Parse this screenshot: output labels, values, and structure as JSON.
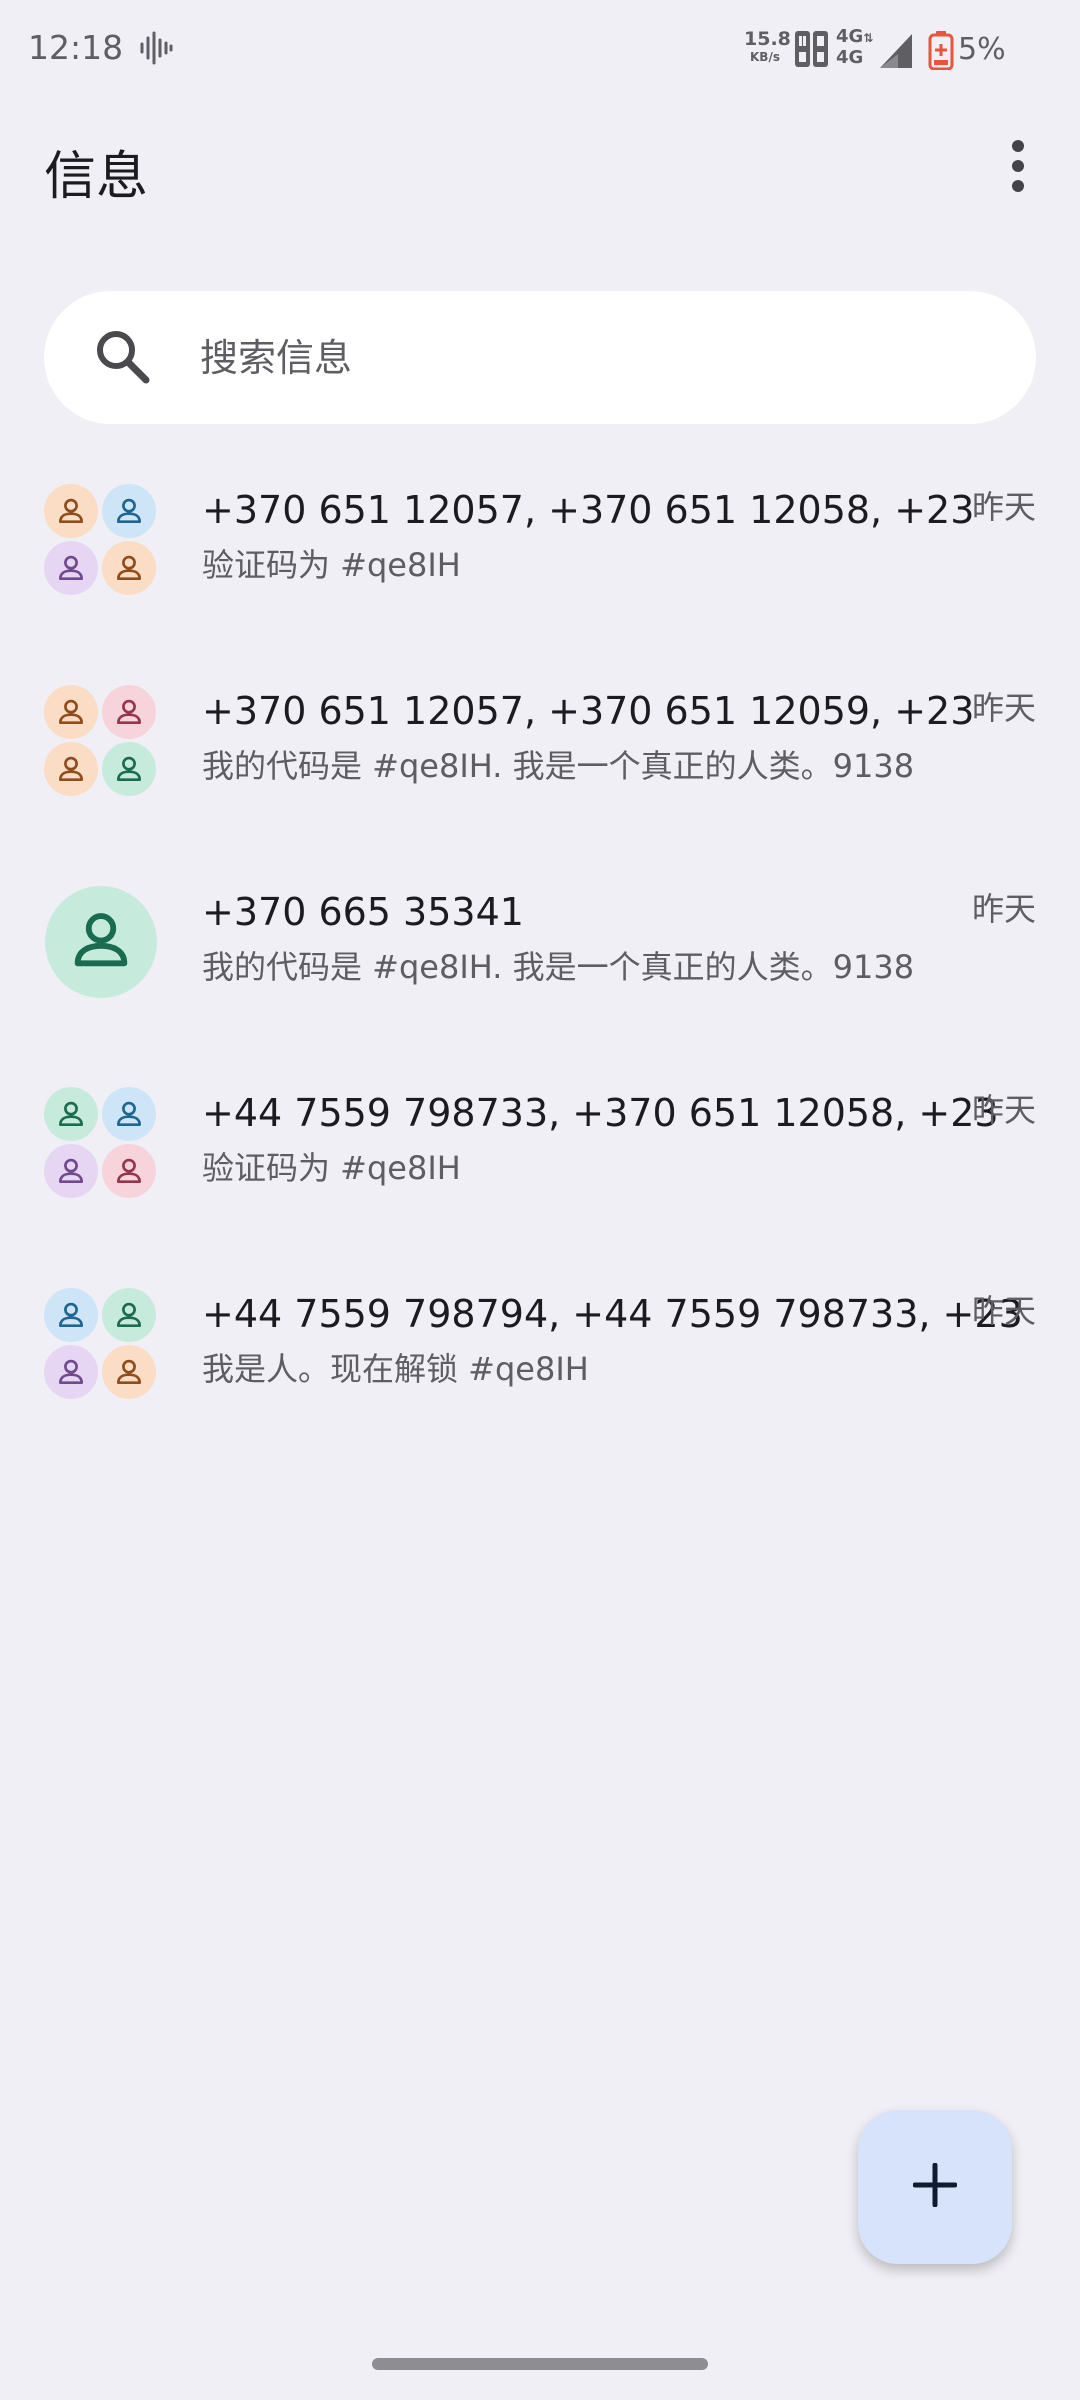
{
  "status_bar": {
    "time": "12:18",
    "speed_value": "15.8",
    "speed_unit": "KB/s",
    "network_top": "4G",
    "network_bottom": "4G",
    "battery": "5%"
  },
  "app_bar": {
    "title": "信息",
    "overflow_icon": "more-vert-icon"
  },
  "search": {
    "placeholder": "搜索信息",
    "icon": "search-icon"
  },
  "conversations": [
    {
      "title": "+370 651 12057, +370 651 12058, +23",
      "snippet": "验证码为 #qe8IH",
      "time": "昨天",
      "avatar_type": "group",
      "avatar_colors": [
        "orange",
        "blue",
        "purple",
        "orange"
      ]
    },
    {
      "title": "+370 651 12057, +370 651 12059, +23",
      "snippet": "我的代码是 #qe8IH. 我是一个真正的人类。9138",
      "time": "昨天",
      "avatar_type": "group",
      "avatar_colors": [
        "orange",
        "pink",
        "orange",
        "green"
      ]
    },
    {
      "title": "+370 665 35341",
      "snippet": "我的代码是 #qe8IH. 我是一个真正的人类。9138",
      "time": "昨天",
      "avatar_type": "single",
      "avatar_colors": [
        "green"
      ]
    },
    {
      "title": "+44 7559 798733, +370 651 12058, +23",
      "snippet": "验证码为 #qe8IH",
      "time": "昨天",
      "avatar_type": "group",
      "avatar_colors": [
        "green",
        "blue",
        "purple",
        "pink"
      ]
    },
    {
      "title": "+44 7559 798794, +44 7559 798733, +23",
      "snippet": "我是人。现在解锁 #qe8IH",
      "time": "昨天",
      "avatar_type": "group",
      "avatar_colors": [
        "blue",
        "green",
        "purple",
        "orange"
      ]
    }
  ],
  "fab": {
    "icon": "plus-icon"
  },
  "colors": {
    "background": "#f0eff5",
    "orange_bg": "#fbdcc4",
    "orange_fg": "#8f4c1c",
    "blue_bg": "#cde5f6",
    "blue_fg": "#1f6590",
    "purple_bg": "#e7d6f3",
    "purple_fg": "#6f4a8d",
    "pink_bg": "#f7d4dc",
    "pink_fg": "#97354d",
    "green_bg": "#c6ebdc",
    "green_fg": "#1a6b50",
    "fab_bg": "#d6e3fb"
  }
}
